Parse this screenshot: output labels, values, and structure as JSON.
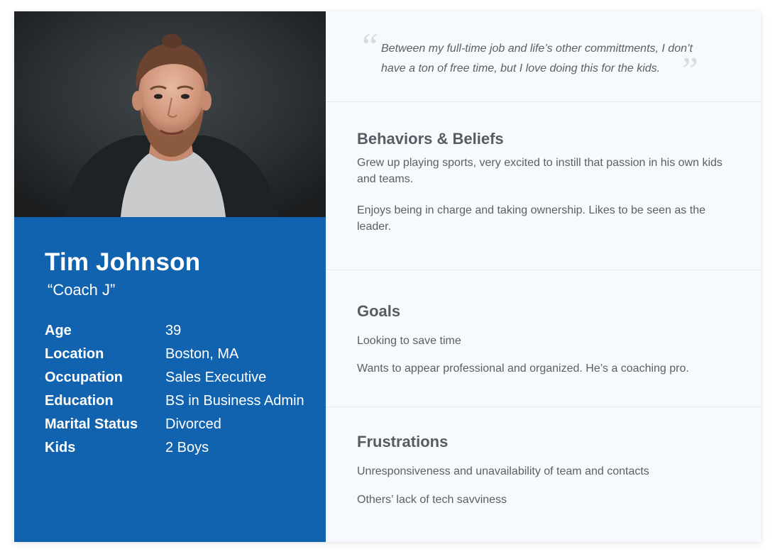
{
  "persona": {
    "name": "Tim Johnson",
    "nickname": "“Coach J”",
    "photo_icon": "persona-photo",
    "facts": [
      {
        "label": "Age",
        "value": "39"
      },
      {
        "label": "Location",
        "value": "Boston, MA"
      },
      {
        "label": "Occupation",
        "value": "Sales Executive"
      },
      {
        "label": "Education",
        "value": "BS in Business Admin"
      },
      {
        "label": "Marital Status",
        "value": "Divorced"
      },
      {
        "label": "Kids",
        "value": "2 Boys"
      }
    ]
  },
  "quote": {
    "open_mark": "“",
    "text": "Between my full-time job and life’s other committments, I don’t have a ton of free time, but I love doing this for the kids.",
    "close_mark": "”"
  },
  "sections": {
    "behaviors": {
      "title": "Behaviors & Beliefs",
      "items": [
        "Grew up playing sports, very excited to instill that passion in his own kids and teams.",
        "Enjoys being in charge and taking ownership. Likes to be seen as the leader."
      ]
    },
    "goals": {
      "title": "Goals",
      "items": [
        "Looking to save time",
        "Wants to appear professional and organized. He’s a coaching pro."
      ]
    },
    "frustrations": {
      "title": "Frustrations",
      "items": [
        "Unresponsiveness and unavailability of team and contacts",
        "Others’ lack of tech savviness"
      ]
    }
  },
  "colors": {
    "profile_bg": "#1163b0",
    "panel_bg": "#f6f9fd",
    "heading": "#575c63",
    "body_text": "#5b6067"
  }
}
